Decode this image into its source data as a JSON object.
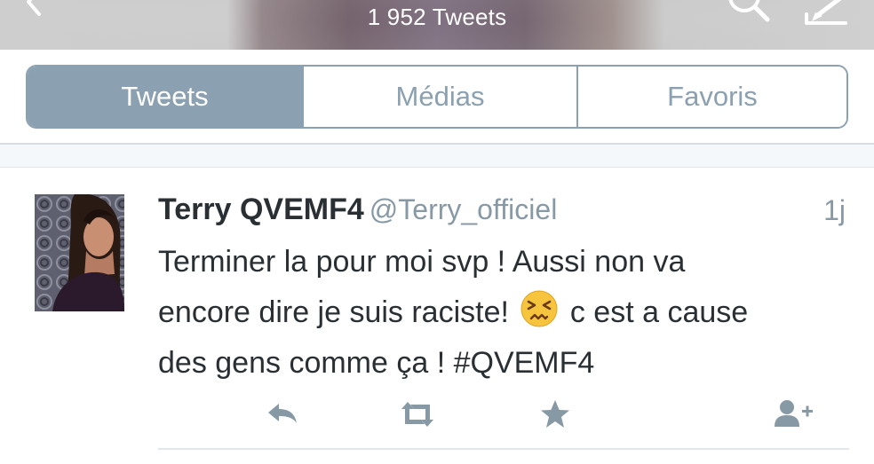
{
  "header": {
    "tweet_count": "1 952 Tweets",
    "back_icon": "chevron-left-icon",
    "search_icon": "search-icon",
    "compose_icon": "compose-icon"
  },
  "tabs": [
    {
      "label": "Tweets",
      "active": true
    },
    {
      "label": "Médias",
      "active": false
    },
    {
      "label": "Favoris",
      "active": false
    }
  ],
  "tweet": {
    "display_name": "Terry QVEMF4",
    "handle": "@Terry_officiel",
    "timestamp": "1j",
    "text_line1": "Terminer la pour moi svp ! Aussi non va",
    "text_line2_pre": "encore dire je suis raciste!",
    "text_line2_post": "c est a cause",
    "text_line3": "des gens comme ça ! #QVEMF4",
    "emoji": "persevering-face-emoji",
    "actions": [
      "reply-icon",
      "retweet-icon",
      "favorite-icon",
      "follow-icon"
    ]
  },
  "colors": {
    "accent": "#8ba0b0",
    "secondary_text": "#8899a6",
    "primary_text": "#292f33"
  }
}
